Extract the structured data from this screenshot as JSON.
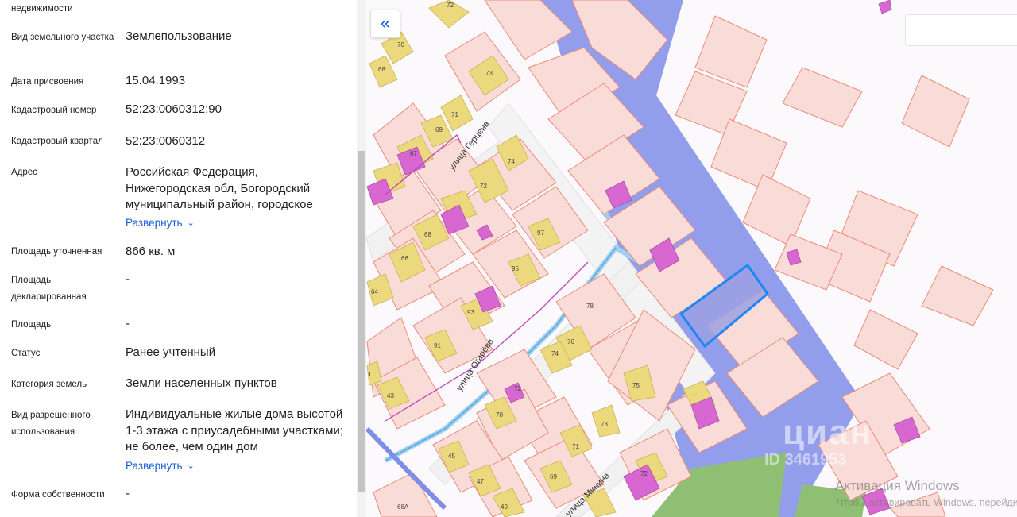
{
  "panel": {
    "top_cut_label": "недвижимости",
    "fields": {
      "vid_uchastka": {
        "label": "Вид земельного участка",
        "value": "Землепользование"
      },
      "data_prisvoeniya": {
        "label": "Дата присвоения",
        "value": "15.04.1993"
      },
      "kad_nomer": {
        "label": "Кадастровый номер",
        "value": "52:23:0060312:90"
      },
      "kad_kvartal": {
        "label": "Кадастровый квартал",
        "value": "52:23:0060312"
      },
      "adres": {
        "label": "Адрес",
        "value": "Российская Федерация, Нижегородская обл, Богородский муниципальный район, городское"
      },
      "ploshchad_utoch": {
        "label": "Площадь уточненная",
        "value": "866 кв. м"
      },
      "ploshchad_dekl": {
        "label": "Площадь декларированная",
        "value": "-"
      },
      "ploshchad": {
        "label": "Площадь",
        "value": "-"
      },
      "status": {
        "label": "Статус",
        "value": "Ранее учтенный"
      },
      "kategoriya": {
        "label": "Категория земель",
        "value": "Земли населенных пунктов"
      },
      "vid_razresh": {
        "label": "Вид разрешенного использования",
        "value": "Индивидуальные жилые дома высотой 1-3 этажа с приусадебными участками; не более, чем один дом"
      },
      "forma_sobstv": {
        "label": "Форма собственности",
        "value": "-"
      }
    },
    "expand_label": "Развернуть"
  },
  "map": {
    "collapse_icon": "double-chevron-left-icon",
    "street_labels": {
      "gertsena": "улица Герцена",
      "ogareva": "улица Огарёва",
      "minina": "улица Минина"
    },
    "plot_numbers": [
      "72",
      "70",
      "68",
      "73",
      "71",
      "69",
      "67",
      "74",
      "72",
      "68",
      "66",
      "97",
      "95",
      "93",
      "64",
      "91",
      "78",
      "76",
      "74",
      "75",
      "43",
      "72",
      "70",
      "73",
      "71",
      "45",
      "69",
      "47",
      "72",
      "49",
      "68А",
      "1"
    ],
    "watermark_logo": "циан",
    "watermark_id": "ID 3461953",
    "activation_title": "Активация Windows",
    "activation_sub": "Чтобы активировать Windows, перейдите"
  },
  "colors": {
    "accent": "#1c5fd6",
    "cadastral_border": "#ef8a78",
    "cadastral_fill": "#f9dcd8",
    "building": "#ecd97e",
    "zone": "#7f8de8",
    "selected_border": "#1f86f2",
    "selected_fill": "#9ca1e3",
    "green_zone": "#8fbf72",
    "magenta_object": "#d867d2",
    "water": "#9ed0ef"
  }
}
